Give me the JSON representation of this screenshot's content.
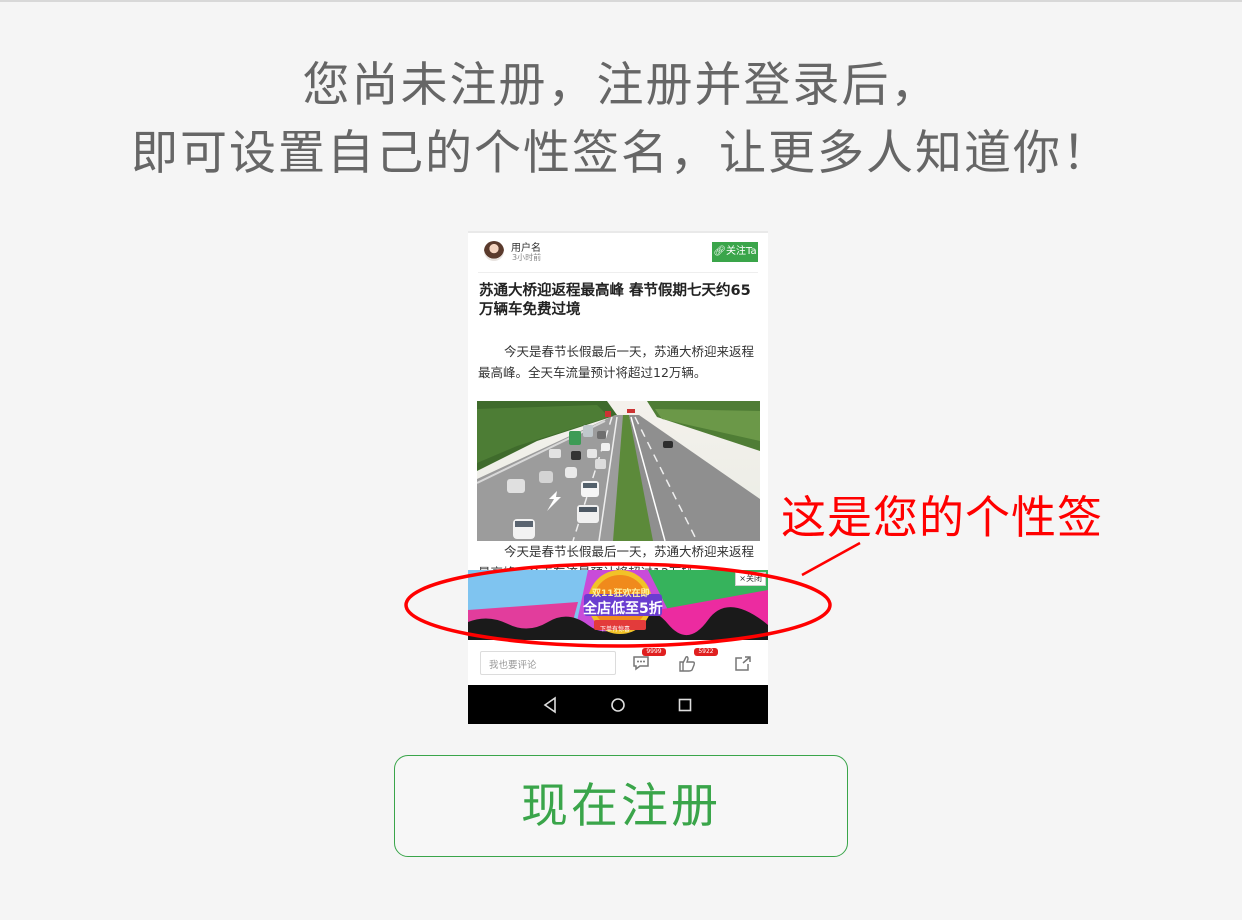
{
  "headline": {
    "line1": "您尚未注册，注册并登录后，",
    "line2": "即可设置自己的个性签名，让更多人知道你！"
  },
  "phone": {
    "user": {
      "name": "用户名",
      "time": "3小时前",
      "follow_label": "关注Ta"
    },
    "article": {
      "title": "苏通大桥迎返程最高峰 春节假期七天约65万辆车免费过境",
      "paragraph": "今天是春节长假最后一天，苏通大桥迎来返程最高峰。全天车流量预计将超过12万辆。",
      "paragraph_repeat": "今天是春节长假最后一天，苏通大桥迎来返程最高峰。全天车流量预计将超过12万辆。"
    },
    "ad": {
      "close_label": "×关闭",
      "line1": "双11狂欢在即",
      "line2": "全店低至5折",
      "line3": "下单有惊喜"
    },
    "comment_bar": {
      "placeholder": "我也要评论",
      "comment_count": "9999",
      "like_count": "5922"
    }
  },
  "annotation": {
    "label": "这是您的个性签"
  },
  "register_button": {
    "label": "现在注册"
  },
  "colors": {
    "background": "#f5f5f5",
    "headline_text": "#666666",
    "accent_green": "#3aa54a",
    "annotation_red": "#ff0000"
  }
}
